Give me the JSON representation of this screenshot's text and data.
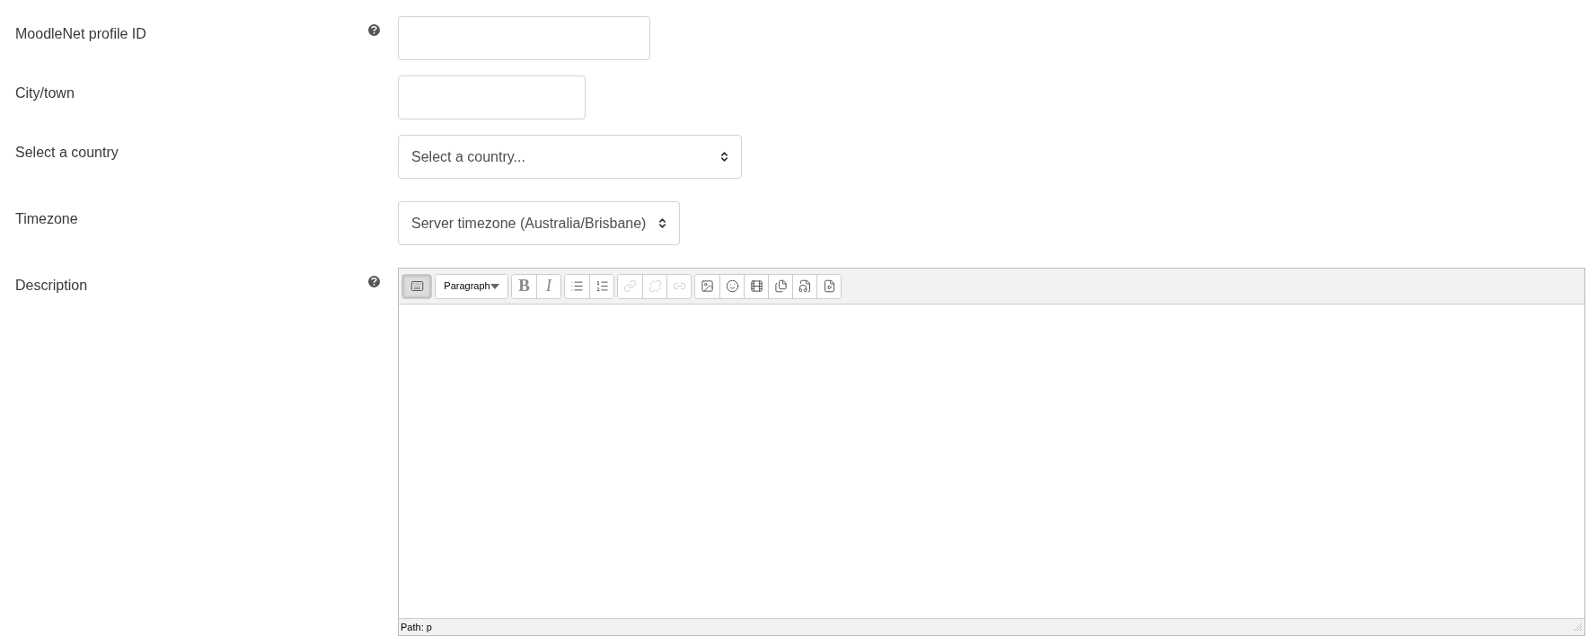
{
  "fields": [
    {
      "label": "MoodleNet profile ID",
      "help": true,
      "kind": "text"
    },
    {
      "label": "City/town",
      "kind": "text"
    },
    {
      "label": "Select a country",
      "kind": "select",
      "value": "Select a country..."
    },
    {
      "label": "Timezone",
      "kind": "select",
      "value": "Server timezone (Australia/Brisbane)"
    }
  ],
  "description": {
    "label": "Description",
    "help": true,
    "toolbar": [
      [
        {
          "kind": "keyboard",
          "selected": true,
          "disabled": false
        }
      ],
      [
        {
          "kind": "format",
          "text": "Paragraph",
          "selected": false,
          "disabled": false
        }
      ],
      [
        {
          "kind": "bold",
          "text": "B",
          "selected": false,
          "disabled": false
        },
        {
          "kind": "italic",
          "text": "I",
          "selected": false,
          "disabled": false
        }
      ],
      [
        {
          "kind": "bullets",
          "selected": false,
          "disabled": false
        },
        {
          "kind": "numbers",
          "selected": false,
          "disabled": false
        }
      ],
      [
        {
          "kind": "link",
          "selected": false,
          "disabled": true
        },
        {
          "kind": "unlink",
          "selected": false,
          "disabled": true
        },
        {
          "kind": "autolink",
          "selected": false,
          "disabled": true
        }
      ],
      [
        {
          "kind": "image",
          "selected": false,
          "disabled": false
        },
        {
          "kind": "emoji",
          "selected": false,
          "disabled": false
        },
        {
          "kind": "media",
          "selected": false,
          "disabled": false
        },
        {
          "kind": "files",
          "selected": false,
          "disabled": false
        },
        {
          "kind": "audio",
          "selected": false,
          "disabled": false
        },
        {
          "kind": "video",
          "selected": false,
          "disabled": false
        }
      ]
    ],
    "path": "Path: p"
  }
}
